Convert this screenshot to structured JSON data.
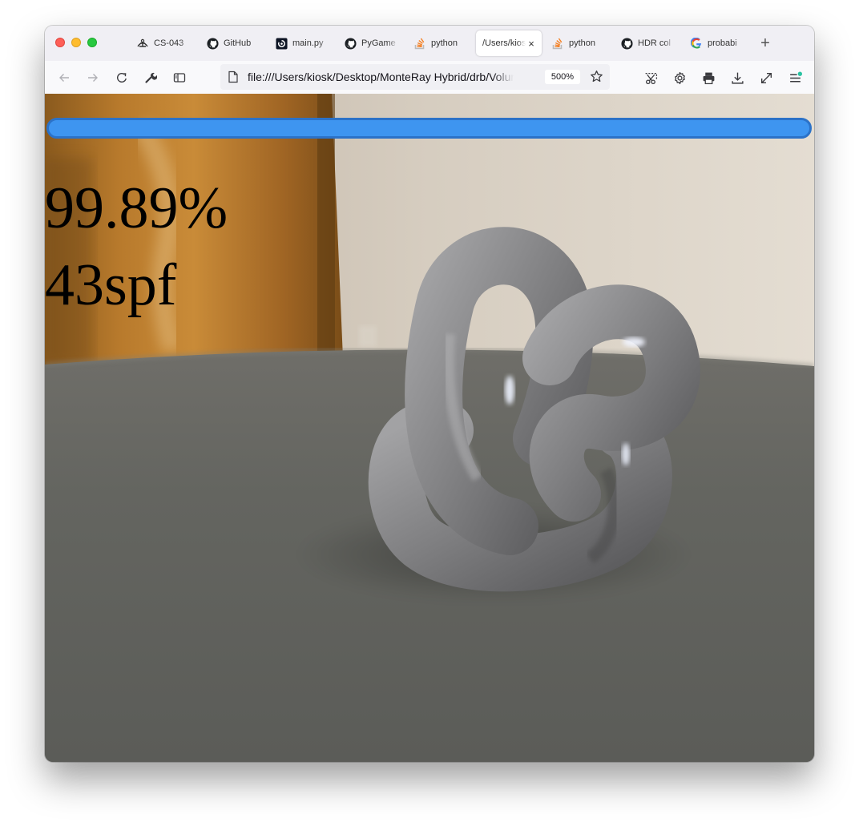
{
  "browser": {
    "tabs": [
      {
        "label": "CS-043",
        "icon": "anchor-icon"
      },
      {
        "label": "GitHub",
        "icon": "github-icon"
      },
      {
        "label": "main.py",
        "icon": "replit-icon"
      },
      {
        "label": "PyGame",
        "icon": "github-icon"
      },
      {
        "label": "python",
        "icon": "stackoverflow-icon"
      },
      {
        "label": "/Users/kiosk",
        "icon": "none",
        "active": true
      },
      {
        "label": "python",
        "icon": "stackoverflow-icon"
      },
      {
        "label": "HDR col",
        "icon": "github-icon"
      },
      {
        "label": "probabi",
        "icon": "google-icon"
      }
    ],
    "new_tab_label": "+",
    "close_glyph": "×",
    "url": "file:///Users/kiosk/Desktop/MonteRay Hybrid/drb/Volumetric",
    "zoom": "500%"
  },
  "page": {
    "progress_percent": 99.89,
    "progress_text": "99.89%",
    "samples_text": "43spf"
  },
  "colors": {
    "progress_fill": "#3e95f0",
    "progress_border": "#2b72c8",
    "tab_strip": "#f0eff4",
    "toolbar": "#f9f9fb"
  }
}
